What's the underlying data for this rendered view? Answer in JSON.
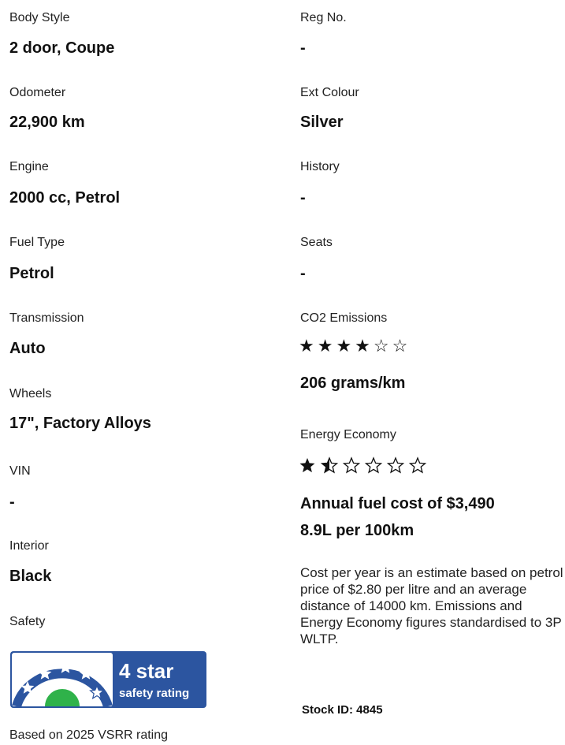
{
  "left": [
    {
      "label": "Body Style",
      "value": "2 door, Coupe"
    },
    {
      "label": "Odometer",
      "value": "22,900 km"
    },
    {
      "label": "Engine",
      "value": "2000 cc, Petrol"
    },
    {
      "label": "Fuel Type",
      "value": "Petrol"
    },
    {
      "label": "Transmission",
      "value": "Auto"
    },
    {
      "label": "Wheels",
      "value": "17\", Factory Alloys"
    },
    {
      "label": "VIN",
      "value": "-"
    },
    {
      "label": "Interior",
      "value": "Black"
    }
  ],
  "safety": {
    "label": "Safety",
    "badge_line1": "4 star",
    "badge_line2": "safety rating",
    "rating_stars": 4,
    "rating_max": 5,
    "colors": {
      "badge_blue": "#2c55a0",
      "green": "#2fb24a",
      "star_blue": "#1d3f94"
    },
    "note": "Based on 2025 VSRR rating"
  },
  "right": [
    {
      "label": "Reg No.",
      "value": "-"
    },
    {
      "label": "Ext Colour",
      "value": "Silver"
    },
    {
      "label": "History",
      "value": "-"
    },
    {
      "label": "Seats",
      "value": "-"
    }
  ],
  "co2": {
    "label": "CO2 Emissions",
    "stars": "★★★★☆☆",
    "rating": 4,
    "rating_max": 6,
    "value": "206 grams/km"
  },
  "energy": {
    "label": "Energy Economy",
    "rating": 1.5,
    "rating_max": 6,
    "annual_cost": "Annual fuel cost of $3,490",
    "consumption": "8.9L per 100km"
  },
  "disclaimer": "Cost per year is an estimate based on petrol price of  $2.80 per litre and an average distance of 14000 km. Emissions and Energy Economy figures standardised to 3P WLTP.",
  "stock_id": "Stock ID: 4845"
}
